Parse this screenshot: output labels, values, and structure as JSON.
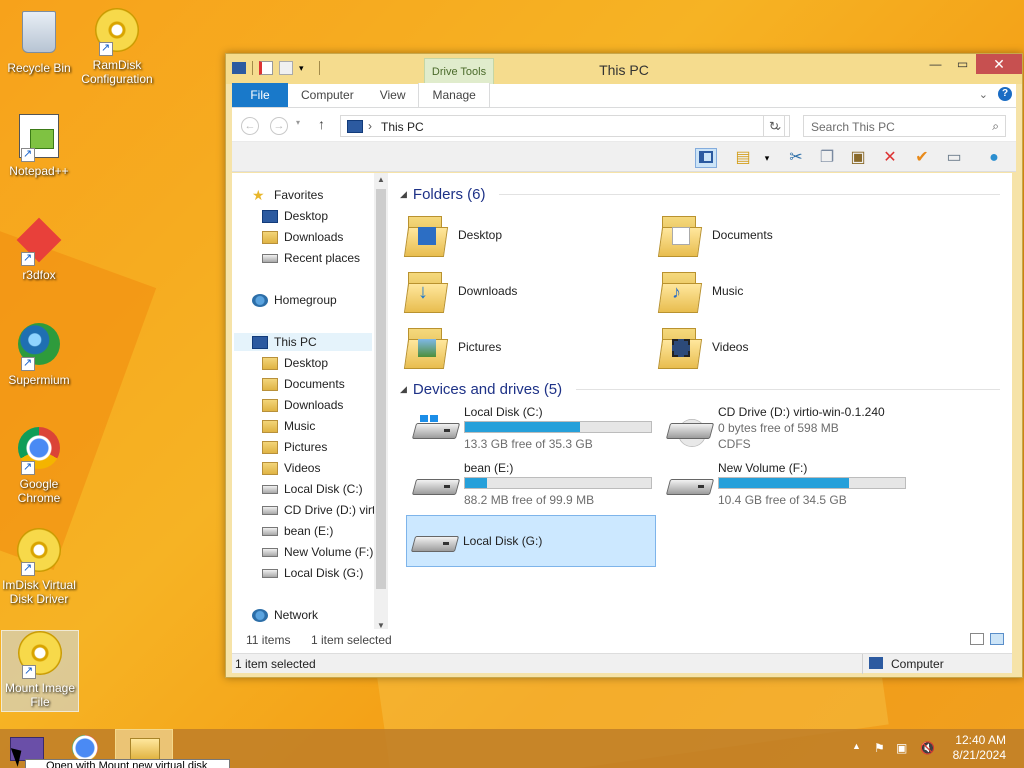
{
  "desktop": {
    "icons": [
      {
        "label": "Recycle Bin",
        "icon": "recycle-bin-icon"
      },
      {
        "label": "RamDisk Configuration",
        "icon": "ramdisk-icon"
      },
      {
        "label": "Notepad++",
        "icon": "notepad-plus-plus-icon"
      },
      {
        "label": "r3dfox",
        "icon": "r3dfox-icon"
      },
      {
        "label": "Supermium",
        "icon": "supermium-icon"
      },
      {
        "label": "Google Chrome",
        "icon": "chrome-icon"
      },
      {
        "label": "ImDisk Virtual Disk Driver",
        "icon": "imdisk-icon"
      },
      {
        "label": "Mount Image File",
        "icon": "mount-image-icon"
      }
    ]
  },
  "window": {
    "title": "This PC",
    "context_tab": "Drive Tools",
    "ribbon_tabs": {
      "file": "File",
      "computer": "Computer",
      "view": "View",
      "manage": "Manage"
    },
    "address": {
      "crumb": "This PC",
      "chevron": "›"
    },
    "search_placeholder": "Search This PC",
    "nav": {
      "favorites": "Favorites",
      "desktop": "Desktop",
      "downloads": "Downloads",
      "recent": "Recent places",
      "homegroup": "Homegroup",
      "thispc": "This PC",
      "pc_desktop": "Desktop",
      "pc_documents": "Documents",
      "pc_downloads": "Downloads",
      "pc_music": "Music",
      "pc_pictures": "Pictures",
      "pc_videos": "Videos",
      "drive_c": "Local Disk (C:)",
      "drive_d": "CD Drive (D:) virt",
      "drive_e": "bean (E:)",
      "drive_f": "New Volume (F:)",
      "drive_g": "Local Disk (G:)",
      "network": "Network"
    },
    "folders_header": "Folders (6)",
    "folders": [
      "Desktop",
      "Documents",
      "Downloads",
      "Music",
      "Pictures",
      "Videos"
    ],
    "drives_header": "Devices and drives (5)",
    "drives": {
      "c": {
        "name": "Local Disk (C:)",
        "free": "13.3 GB free of 35.3 GB",
        "used_fraction": 0.62
      },
      "d": {
        "name": "CD Drive (D:) virtio-win-0.1.240",
        "free": "0 bytes free of 598 MB",
        "fs": "CDFS"
      },
      "e": {
        "name": "bean (E:)",
        "free": "88.2 MB free of 99.9 MB",
        "used_fraction": 0.12
      },
      "f": {
        "name": "New Volume (F:)",
        "free": "10.4 GB free of 34.5 GB",
        "used_fraction": 0.7
      },
      "g": {
        "name": "Local Disk (G:)"
      }
    },
    "status": {
      "items": "11 items",
      "selected": "1 item selected"
    },
    "footer": {
      "left": "1 item selected",
      "right": "Computer"
    }
  },
  "taskbar": {
    "time": "12:40 AM",
    "date": "8/21/2024",
    "tooltip": "Open with Mount new virtual disk"
  },
  "colors": {
    "accent": "#1979ca",
    "progress": "#26a0da",
    "close": "#c75050"
  }
}
